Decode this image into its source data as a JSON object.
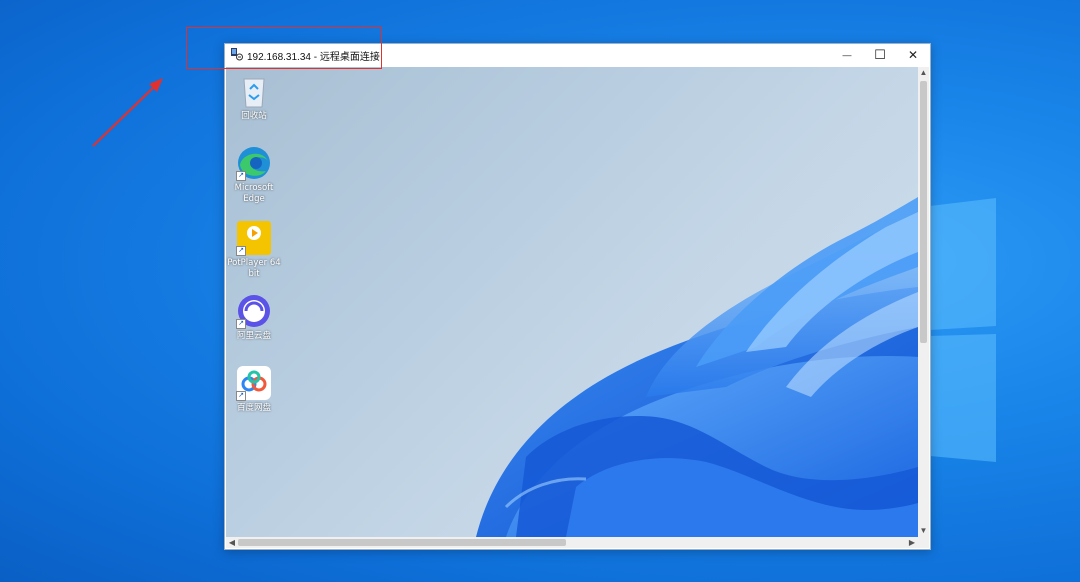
{
  "window": {
    "title": "192.168.31.34 - 远程桌面连接",
    "app_icon": "remote-desktop-icon",
    "controls": {
      "minimize_glyph": "—",
      "maximize_glyph": "☐",
      "close_glyph": "✕"
    }
  },
  "remote_desktop": {
    "icons": [
      {
        "name": "recycle-bin-icon",
        "label": "回收站"
      },
      {
        "name": "microsoft-edge-icon",
        "label": "Microsoft Edge"
      },
      {
        "name": "potplayer-icon",
        "label": "PotPlayer 64 bit"
      },
      {
        "name": "aliyun-drive-icon",
        "label": "阿里云盘"
      },
      {
        "name": "baidu-netdisk-icon",
        "label": "百度网盘"
      }
    ]
  },
  "scrollbars": {
    "up": "▲",
    "down": "▼",
    "left": "◀",
    "right": "▶"
  },
  "colors": {
    "annotation": "#e0312f",
    "host_background": "#1a86ea"
  }
}
